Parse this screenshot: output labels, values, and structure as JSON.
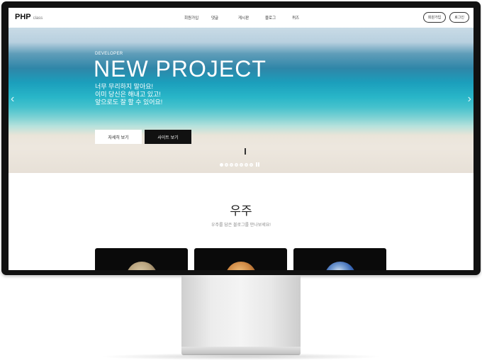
{
  "header": {
    "logo": "PHP",
    "logo_sub": "class",
    "nav": [
      "회원가입",
      "댓글",
      "게시판",
      "블로그",
      "퀴즈"
    ],
    "signup_label": "회원가입",
    "login_label": "로그인"
  },
  "hero": {
    "eyebrow": "DEVELOPER",
    "title": "NEW PROJECT",
    "lines": [
      "너무 무리하지 말아요!",
      "이미 당신은 해내고 있고!",
      "앞으로도 잘 할 수 있어요!"
    ],
    "detail_button": "자세히 보기",
    "site_button": "사이트 보기",
    "slide_count": 7,
    "active_slide": 1
  },
  "space": {
    "title": "우주",
    "subtitle": "우주를 담은 블로그를 만나보세요!",
    "cards": [
      {
        "planet": "jupiter"
      },
      {
        "planet": "mars"
      },
      {
        "planet": "earth"
      }
    ]
  },
  "colors": {
    "header_bg": "#ffffff",
    "button_dark": "#111111",
    "monitor_bezel": "#111111"
  }
}
